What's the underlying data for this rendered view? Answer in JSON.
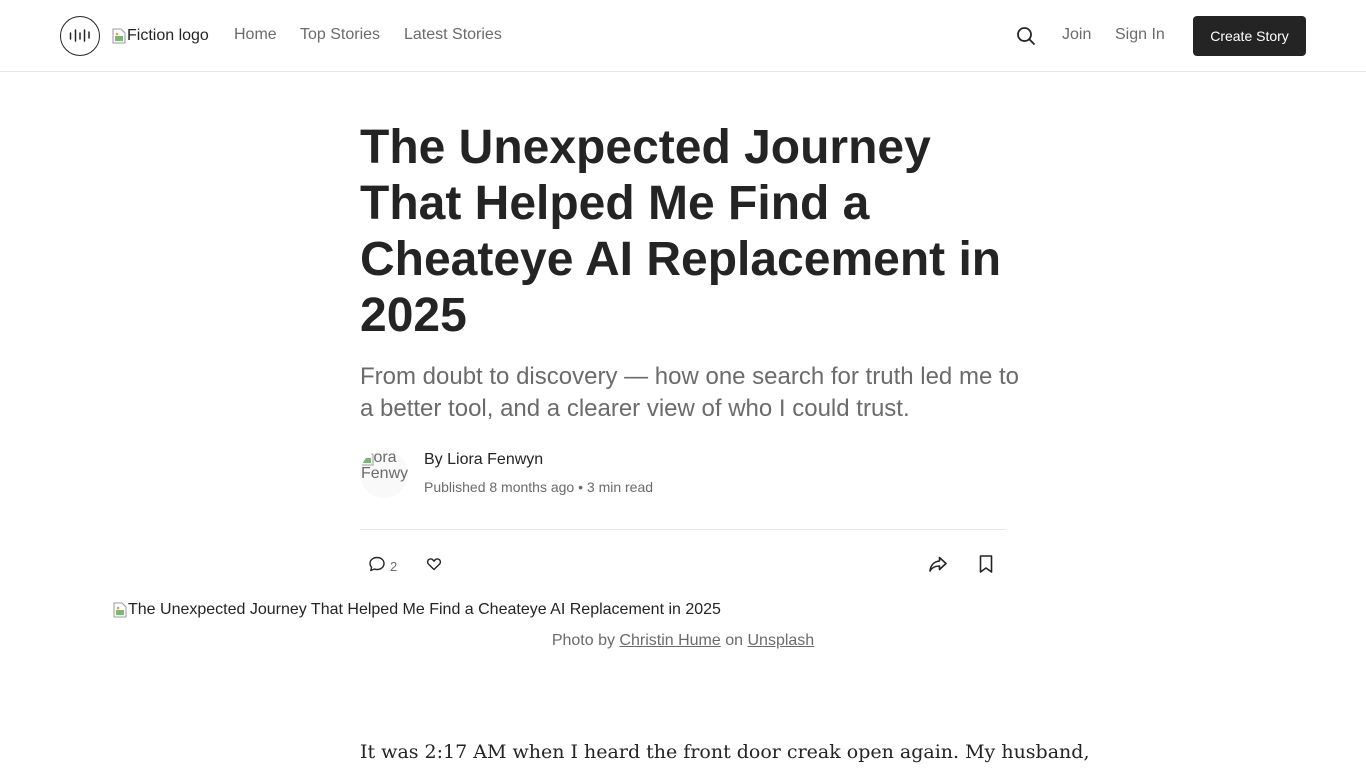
{
  "header": {
    "logo_alt": "Fiction logo",
    "nav": {
      "home": "Home",
      "top_stories": "Top Stories",
      "latest_stories": "Latest Stories"
    },
    "search_icon": "search-icon",
    "join": "Join",
    "sign_in": "Sign In",
    "create_story": "Create Story"
  },
  "article": {
    "title": "The Unexpected Journey That Helped Me Find a Cheateye AI Replacement in 2025",
    "subtitle": "From doubt to discovery — how one search for truth led me to a better tool, and a clearer view of who I could trust.",
    "author": {
      "avatar_alt": "Liora Fenwyn",
      "byline": "By Liora Fenwyn",
      "meta": "Published 8 months ago • 3 min read"
    },
    "actions": {
      "comment_count": "2",
      "icons": [
        "comment-icon",
        "heart-icon",
        "share-icon",
        "bookmark-icon"
      ]
    },
    "hero_image_alt": "The Unexpected Journey That Helped Me Find a Cheateye AI Replacement in 2025",
    "caption": {
      "prefix": "Photo by",
      "photographer": "Christin Hume",
      "on": "on",
      "source": "Unsplash"
    },
    "first_paragraph": "It was 2:17 AM when I heard the front door creak open again. My husband,"
  },
  "colors": {
    "text": "#242424",
    "muted": "#6b6b6b",
    "button_bg": "#242424",
    "divider": "#e6e6e6"
  }
}
